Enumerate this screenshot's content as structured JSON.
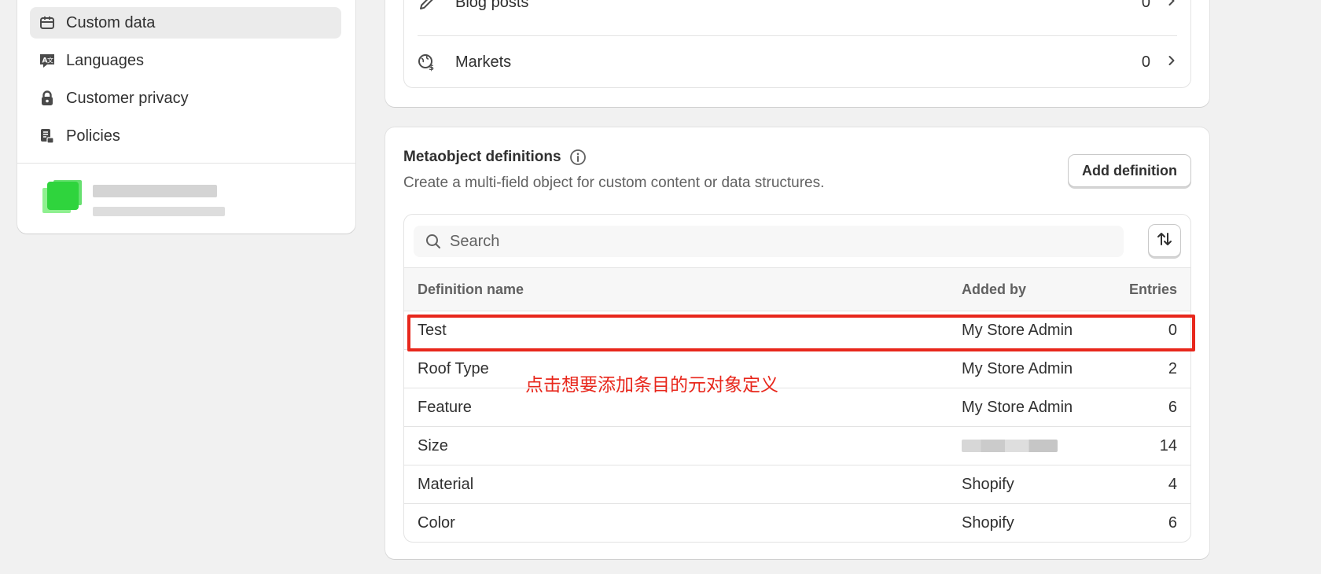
{
  "sidebar": {
    "items": [
      {
        "label": "Custom data",
        "icon": "custom-data-icon",
        "active": true
      },
      {
        "label": "Languages",
        "icon": "languages-icon",
        "active": false
      },
      {
        "label": "Customer privacy",
        "icon": "lock-icon",
        "active": false
      },
      {
        "label": "Policies",
        "icon": "policies-icon",
        "active": false
      }
    ]
  },
  "top_list": {
    "rows": [
      {
        "label": "Blog posts",
        "count": "0",
        "icon": "pencil-icon"
      },
      {
        "label": "Markets",
        "count": "0",
        "icon": "globe-dollar-icon"
      }
    ]
  },
  "metaobjects": {
    "title": "Metaobject definitions",
    "description": "Create a multi-field object for custom content or data structures.",
    "add_button": "Add definition",
    "search_placeholder": "Search",
    "columns": {
      "name": "Definition name",
      "added_by": "Added by",
      "entries": "Entries"
    },
    "rows": [
      {
        "name": "Test",
        "added_by": "My Store Admin",
        "entries": "0"
      },
      {
        "name": "Roof Type",
        "added_by": "My Store Admin",
        "entries": "2"
      },
      {
        "name": "Feature",
        "added_by": "My Store Admin",
        "entries": "6"
      },
      {
        "name": "Size",
        "added_by": "",
        "entries": "14"
      },
      {
        "name": "Material",
        "added_by": "Shopify",
        "entries": "4"
      },
      {
        "name": "Color",
        "added_by": "Shopify",
        "entries": "6"
      }
    ]
  },
  "annotation": {
    "text": "点击想要添加条目的元对象定义",
    "color": "#e8271c"
  }
}
